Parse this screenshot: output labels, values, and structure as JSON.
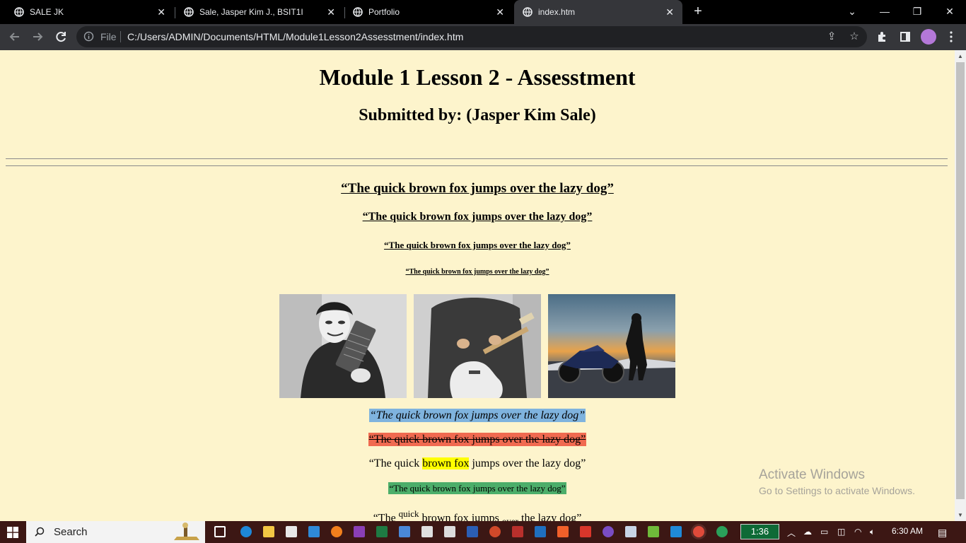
{
  "browser": {
    "tabs": [
      {
        "title": "SALE JK",
        "active": false
      },
      {
        "title": "Sale, Jasper Kim J., BSIT1I",
        "active": false
      },
      {
        "title": "Portfolio",
        "active": false
      },
      {
        "title": "index.htm",
        "active": true
      }
    ],
    "omnibox": {
      "scheme_label": "File",
      "url": "C:/Users/ADMIN/Documents/HTML/Module1Lesson2Assesstment/index.htm"
    },
    "icons": {
      "back": "arrow-left-icon",
      "forward": "arrow-right-icon",
      "reload": "reload-icon",
      "share": "share-icon",
      "bookmark": "star-icon",
      "extensions": "puzzle-icon",
      "sidepanel": "side-panel-icon",
      "menu": "kebab-menu-icon"
    }
  },
  "page": {
    "title": "Module 1 Lesson 2 - Assesstment",
    "subtitle": "Submitted by: (Jasper Kim Sale)",
    "headings": [
      "“The quick brown fox jumps over the lazy dog”",
      "“The quick brown fox jumps over the lazy dog”",
      "“The quick brown fox jumps over the lazy dog”",
      "“The quick brown fox jumps over the lazy dog”"
    ],
    "images": [
      "masked-hacker-photo",
      "guitarist-photo",
      "motorcycle-rider-photo"
    ],
    "formatted": {
      "italic": "“The quick brown fox jumps over the lazy dog”",
      "strike": "“The quick brown fox jumps over the lazy dog”",
      "mark": {
        "before": "“The quick ",
        "highlight": "brown fox",
        "after": " jumps over the lazy dog”"
      },
      "small": "“The quick brown fox jumps over the lazy dog”",
      "supsub": {
        "p1": "“The ",
        "sup": "quick",
        "p2": " brown fox jumps ",
        "sub": "over",
        "p3": " the lazy dog”"
      }
    },
    "colors": {
      "background": "#fdf4cc",
      "italic_bg": "#7fb3de",
      "strike_bg": "#f06a50",
      "mark_bg": "#ffff00",
      "small_bg": "#4cae6a"
    }
  },
  "watermark": {
    "line1": "Activate Windows",
    "line2": "Go to Settings to activate Windows."
  },
  "taskbar": {
    "search_placeholder": "Search",
    "timer": "1:36",
    "time": "6:30 AM"
  }
}
